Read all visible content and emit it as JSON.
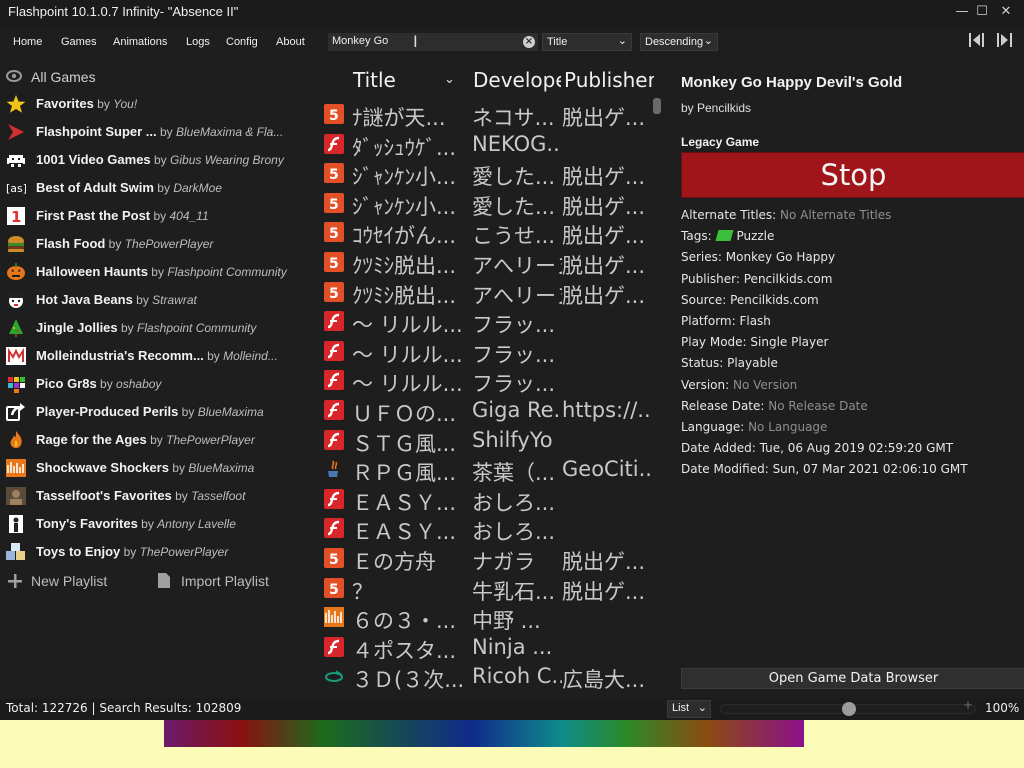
{
  "window": {
    "title": "Flashpoint 10.1.0.7 Infinity- \"Absence II\""
  },
  "menu": [
    "Home",
    "Games",
    "Animations",
    "Logs",
    "Config",
    "About"
  ],
  "search": {
    "value": "Monkey Go"
  },
  "order_by": {
    "value": "Title"
  },
  "order_dir": {
    "value": "Descending"
  },
  "sidebar": {
    "all_games": "All Games",
    "playlists": [
      {
        "title": "Favorites",
        "by": "by",
        "author": "You!",
        "icon": "star-icon",
        "color": "#f2c21b"
      },
      {
        "title": "Flashpoint Super ...",
        "by": "by",
        "author": "BlueMaxima & Fla...",
        "icon": "flashpoint-logo-icon",
        "color": "#d23030"
      },
      {
        "title": "1001 Video Games",
        "by": "by",
        "author": "Gibus Wearing Brony",
        "icon": "space-invader-icon",
        "color": "#ffffff"
      },
      {
        "title": "Best of Adult Swim",
        "by": "by",
        "author": "DarkMoe",
        "icon": "adult-swim-logo-icon",
        "color": "#ffffff"
      },
      {
        "title": "First Past the Post",
        "by": "by",
        "author": "404_11",
        "icon": "number-one-icon",
        "color": "#e03030"
      },
      {
        "title": "Flash Food",
        "by": "by",
        "author": "ThePowerPlayer",
        "icon": "burger-icon",
        "color": "#d08a2a"
      },
      {
        "title": "Halloween Haunts",
        "by": "by",
        "author": "Flashpoint Community",
        "icon": "pumpkin-icon",
        "color": "#e8761b"
      },
      {
        "title": "Hot Java Beans",
        "by": "by",
        "author": "Strawrat",
        "icon": "mascot-icon",
        "color": "#ffffff"
      },
      {
        "title": "Jingle Jollies",
        "by": "by",
        "author": "Flashpoint Community",
        "icon": "christmas-tree-icon",
        "color": "#2aa52a"
      },
      {
        "title": "Molleindustria's Recomm...",
        "by": "by",
        "author": "Molleind...",
        "icon": "molleindustria-icon",
        "color": "#d23030"
      },
      {
        "title": "Pico Gr8s",
        "by": "by",
        "author": "oshaboy",
        "icon": "pixel-grid-icon",
        "color": "#30c0d0"
      },
      {
        "title": "Player-Produced Perils",
        "by": "by",
        "author": "BlueMaxima",
        "icon": "share-arrow-icon",
        "color": "#ffffff"
      },
      {
        "title": "Rage for the Ages",
        "by": "by",
        "author": "ThePowerPlayer",
        "icon": "flame-icon",
        "color": "#e8761b"
      },
      {
        "title": "Shockwave Shockers",
        "by": "by",
        "author": "BlueMaxima",
        "icon": "shockwave-icon",
        "color": "#e8761b"
      },
      {
        "title": "Tasselfoot's Favorites",
        "by": "by",
        "author": "Tasselfoot",
        "icon": "avatar-icon",
        "color": "#a08060"
      },
      {
        "title": "Tony's Favorites",
        "by": "by",
        "author": "Antony Lavelle",
        "icon": "figure-icon",
        "color": "#ffffff"
      },
      {
        "title": "Toys to Enjoy",
        "by": "by",
        "author": "ThePowerPlayer",
        "icon": "toy-blocks-icon",
        "color": "#9bb5d8"
      }
    ],
    "new_playlist": "New Playlist",
    "import_playlist": "Import Playlist"
  },
  "game_list": {
    "headers": {
      "title": "Title",
      "developer": "Develope",
      "publisher": "Publisher"
    },
    "rows": [
      {
        "icon": "html5",
        "title": "ﾅ謎が天...",
        "developer": "ネコサ...",
        "publisher": "脱出ゲ..."
      },
      {
        "icon": "flash",
        "title": "ﾀﾞｯｼｭｳｹﾞ...",
        "developer": "NEKOG...",
        "publisher": ""
      },
      {
        "icon": "html5",
        "title": "ｼﾞｬﾝｹﾝ小...",
        "developer": "愛した...",
        "publisher": "脱出ゲ..."
      },
      {
        "icon": "html5",
        "title": "ｼﾞｬﾝｹﾝ小...",
        "developer": "愛した...",
        "publisher": "脱出ゲ..."
      },
      {
        "icon": "html5",
        "title": "ｺｳｾｲがん...",
        "developer": "こうせ...",
        "publisher": "脱出ゲ..."
      },
      {
        "icon": "html5",
        "title": "ｸﾂﾐｼ脱出...",
        "developer": "アへリーヌ",
        "publisher": "脱出ゲ..."
      },
      {
        "icon": "html5",
        "title": "ｸﾂﾐｼ脱出...",
        "developer": "アへリーヌ",
        "publisher": "脱出ゲ..."
      },
      {
        "icon": "flash",
        "title": "～ リルル...",
        "developer": "フラッ...",
        "publisher": ""
      },
      {
        "icon": "flash",
        "title": "～ リルル...",
        "developer": "フラッ...",
        "publisher": ""
      },
      {
        "icon": "flash",
        "title": "～ リルル...",
        "developer": "フラッ...",
        "publisher": ""
      },
      {
        "icon": "flash",
        "title": "ＵＦＯの...",
        "developer": "Giga Re...",
        "publisher": "https://..."
      },
      {
        "icon": "flash",
        "title": "ＳＴＧ風...",
        "developer": "ShilfyYo",
        "publisher": ""
      },
      {
        "icon": "java",
        "title": "ＲＰＧ風...",
        "developer": "茶葉（...",
        "publisher": "GeoCiti..."
      },
      {
        "icon": "flash",
        "title": "ＥＡＳＹ...",
        "developer": "おしろ...",
        "publisher": ""
      },
      {
        "icon": "flash",
        "title": "ＥＡＳＹ...",
        "developer": "おしろ...",
        "publisher": ""
      },
      {
        "icon": "html5",
        "title": "Ｅの方舟",
        "developer": "ナガラ",
        "publisher": "脱出ゲ..."
      },
      {
        "icon": "html5",
        "title": "？",
        "developer": "牛乳石...",
        "publisher": "脱出ゲ..."
      },
      {
        "icon": "shockwave",
        "title": "６の３・...",
        "developer": "中野 ...",
        "publisher": ""
      },
      {
        "icon": "flash",
        "title": "４ポスタ...",
        "developer": "Ninja ...",
        "publisher": ""
      },
      {
        "icon": "unity",
        "title": "３Ｄ(３次...",
        "developer": "Ricoh C...",
        "publisher": "広島大..."
      }
    ]
  },
  "details": {
    "title": "Monkey Go Happy Devil's Gold",
    "by": "by Pencilkids",
    "library": "Legacy Game",
    "stop_label": "Stop",
    "fields": [
      {
        "label": "Alternate Titles:",
        "value": "No Alternate Titles",
        "muted": true
      },
      {
        "label": "Tags:",
        "value": "Puzzle",
        "muted": false,
        "tag": true
      },
      {
        "label": "Series:",
        "value": "Monkey Go Happy",
        "muted": false
      },
      {
        "label": "Publisher:",
        "value": "Pencilkids.com",
        "muted": false
      },
      {
        "label": "Source:",
        "value": "Pencilkids.com",
        "muted": false
      },
      {
        "label": "Platform:",
        "value": "Flash",
        "muted": false
      },
      {
        "label": "Play Mode:",
        "value": "Single Player",
        "muted": false
      },
      {
        "label": "Status:",
        "value": "Playable",
        "muted": false
      },
      {
        "label": "Version:",
        "value": "No Version",
        "muted": true
      },
      {
        "label": "Release Date:",
        "value": "No Release Date",
        "muted": true
      },
      {
        "label": "Language:",
        "value": "No Language",
        "muted": true
      },
      {
        "label": "Date Added:",
        "value": " Tue, 06 Aug 2019 02:59:20 GMT",
        "muted": false
      },
      {
        "label": "Date Modified:",
        "value": " Sun, 07 Mar 2021 02:06:10 GMT",
        "muted": false
      }
    ],
    "open_browser": "Open Game Data Browser"
  },
  "status": {
    "text": "Total: 122726  |  Search Results: 102809",
    "view": "List",
    "zoom_fraction": 0.5,
    "zoom_label": "100%"
  },
  "colors": {
    "accent_stop": "#a0151a",
    "html5": "#e34f26",
    "flash": "#d8262b"
  }
}
